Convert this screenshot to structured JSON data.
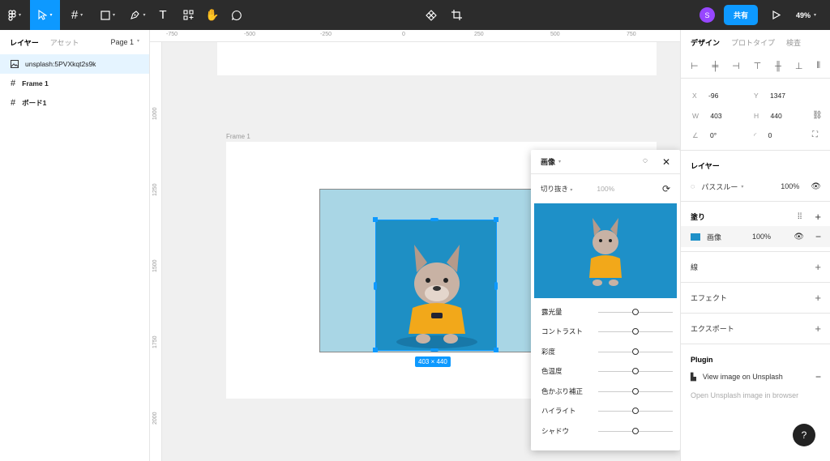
{
  "toolbar": {
    "share_label": "共有",
    "avatar_initial": "S",
    "zoom_label": "49%"
  },
  "left_panel": {
    "tab_layers": "レイヤー",
    "tab_assets": "アセット",
    "page_label": "Page 1",
    "layers": [
      {
        "name": "unsplash:5PVXkqt2s9k",
        "icon": "image-icon",
        "selected": true
      },
      {
        "name": "Frame 1",
        "icon": "frame-icon",
        "selected": false
      },
      {
        "name": "ボード1",
        "icon": "frame-icon",
        "selected": false
      }
    ]
  },
  "rulers": {
    "horizontal": [
      "-750",
      "-500",
      "-250",
      "0",
      "250",
      "500",
      "750"
    ],
    "vertical": [
      "1000",
      "1250",
      "1500",
      "1750",
      "2000"
    ]
  },
  "canvas": {
    "frame_label": "Frame 1",
    "dimensions": "403 × 440"
  },
  "image_popup": {
    "title": "画像",
    "mode": "切り抜き",
    "opacity": "100%",
    "adjustments": [
      {
        "label": "露光量",
        "value": 0
      },
      {
        "label": "コントラスト",
        "value": 0
      },
      {
        "label": "彩度",
        "value": 0
      },
      {
        "label": "色温度",
        "value": 0
      },
      {
        "label": "色かぶり補正",
        "value": 0
      },
      {
        "label": "ハイライト",
        "value": 0
      },
      {
        "label": "シャドウ",
        "value": 0
      }
    ]
  },
  "right_panel": {
    "tab_design": "デザイン",
    "tab_prototype": "プロトタイプ",
    "tab_inspect": "検査",
    "x_label": "X",
    "x_value": "-96",
    "y_label": "Y",
    "y_value": "1347",
    "w_label": "W",
    "w_value": "403",
    "h_label": "H",
    "h_value": "440",
    "rotation_value": "0°",
    "radius_value": "0",
    "layer_title": "レイヤー",
    "blend_mode": "パススルー",
    "layer_opacity": "100%",
    "fill_title": "塗り",
    "fill_type": "画像",
    "fill_opacity": "100%",
    "stroke_title": "線",
    "effect_title": "エフェクト",
    "export_title": "エクスポート",
    "plugin_title": "Plugin",
    "plugin_item": "View image on Unsplash",
    "plugin_sub": "Open Unsplash image in browser"
  },
  "help_label": "?"
}
